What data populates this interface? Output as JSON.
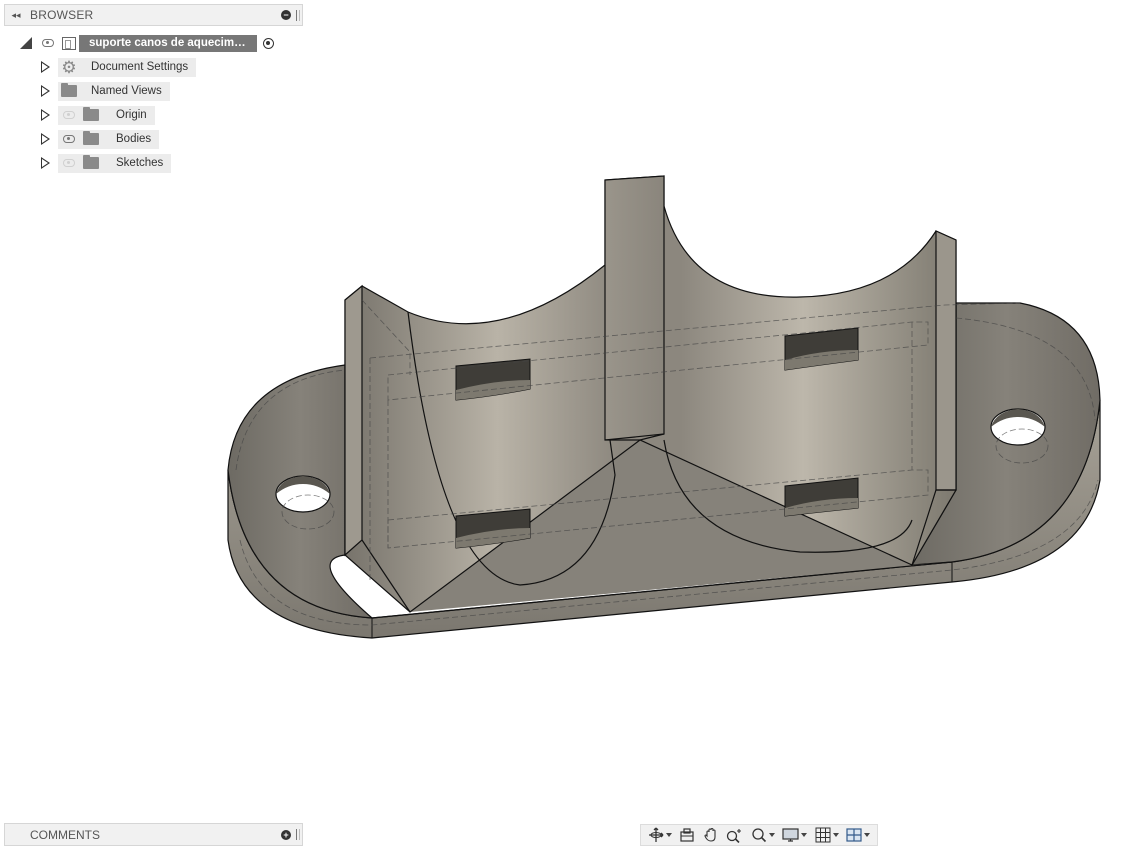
{
  "browser": {
    "title": "BROWSER",
    "root": {
      "label": "suporte canos de aquecimer..."
    },
    "items": [
      {
        "label": "Document Settings",
        "icon": "gear-icon",
        "visibility": "none"
      },
      {
        "label": "Named Views",
        "icon": "folder-icon",
        "visibility": "none"
      },
      {
        "label": "Origin",
        "icon": "folder-icon",
        "visibility": "hidden"
      },
      {
        "label": "Bodies",
        "icon": "folder-icon",
        "visibility": "visible"
      },
      {
        "label": "Sketches",
        "icon": "folder-icon",
        "visibility": "hidden"
      }
    ]
  },
  "comments": {
    "title": "COMMENTS"
  },
  "nav_toolbar": {
    "tools": [
      "orbit-icon",
      "look-at-icon",
      "pan-icon",
      "zoom-icon",
      "fit-icon",
      "display-settings-icon",
      "grid-icon",
      "viewports-icon"
    ]
  },
  "colors": {
    "model_fill": "#8f8a80",
    "model_dark": "#6e6a62",
    "panel_bg": "#f1f1f1",
    "root_highlight": "#777777"
  }
}
